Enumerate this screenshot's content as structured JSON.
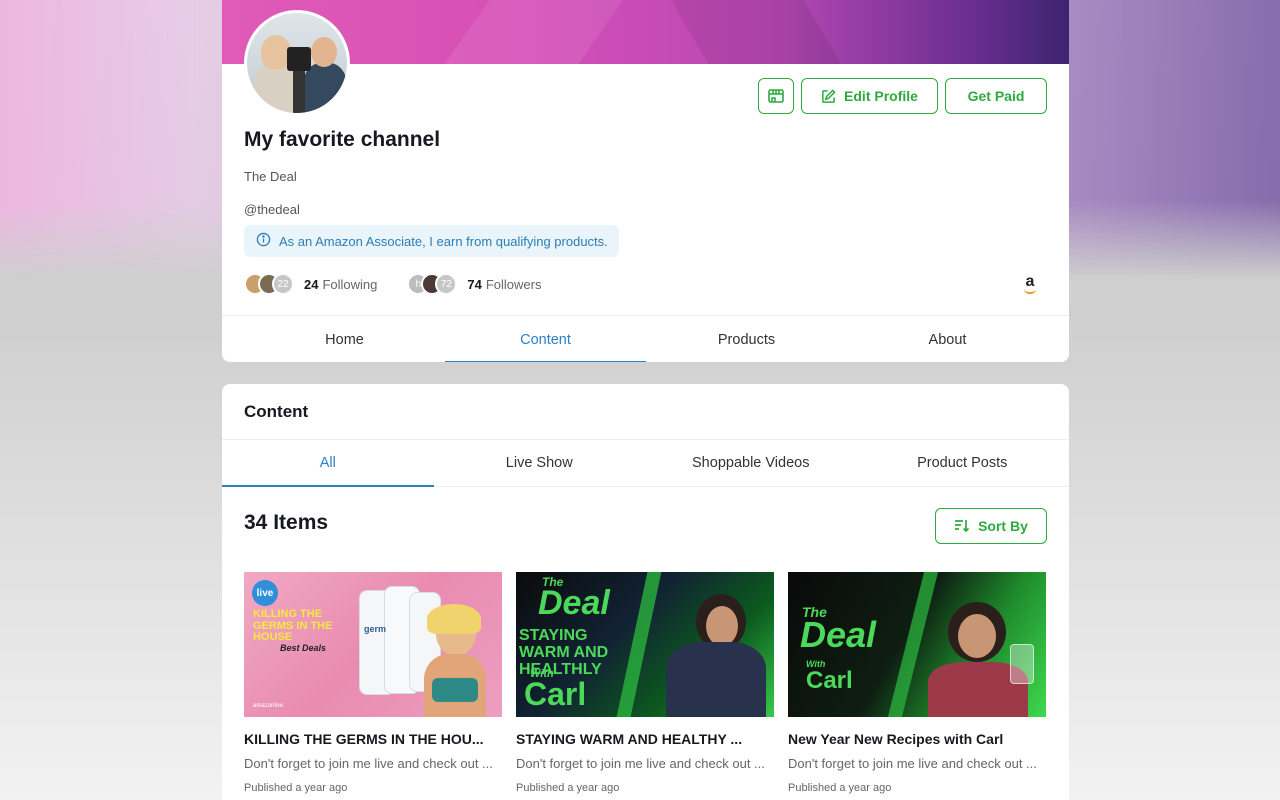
{
  "profile": {
    "title": "My favorite channel",
    "name": "The Deal",
    "handle": "@thedeal",
    "notice": "As an Amazon Associate, I earn from qualifying products.",
    "edit_label": "Edit Profile",
    "paid_label": "Get Paid",
    "following_count": "24",
    "following_label": "Following",
    "following_more": "22",
    "followers_count": "74",
    "followers_label": "Followers",
    "followers_more": "72",
    "followers_initial": "h",
    "amazon_letter": "a"
  },
  "tabs": [
    {
      "label": "Home"
    },
    {
      "label": "Content"
    },
    {
      "label": "Products"
    },
    {
      "label": "About"
    }
  ],
  "content": {
    "title": "Content",
    "subtabs": [
      {
        "label": "All"
      },
      {
        "label": "Live Show"
      },
      {
        "label": "Shoppable Videos"
      },
      {
        "label": "Product Posts"
      }
    ],
    "items_count": "34 Items",
    "sort_label": "Sort By",
    "cards": [
      {
        "title": "KILLING THE GERMS IN THE HOU...",
        "desc": "Don't forget to join me live and check out ...",
        "date": "Published a year ago",
        "thumb_text": "KILLING THE GERMS IN THE HOUSE",
        "thumb_sub": "Best Deals",
        "thumb_badge": "live",
        "thumb_footer": "amazonlive",
        "product_word": "germ"
      },
      {
        "title": "STAYING WARM AND HEALTHY ...",
        "desc": "Don't forget to join me live and check out ...",
        "date": "Published a year ago",
        "brand_top": "The",
        "brand_main": "Deal",
        "thumb_text": "STAYING WARM AND HEALTHLY",
        "thumb_with": "With",
        "thumb_name": "Carl"
      },
      {
        "title": "New Year New Recipes with Carl",
        "desc": "Don't forget to join me live and check out ...",
        "date": "Published a year ago",
        "brand_top": "The",
        "brand_main": "Deal",
        "thumb_with": "With",
        "thumb_name": "Carl"
      }
    ]
  },
  "colors": {
    "accent_green": "#2eaa3f",
    "accent_blue": "#2a82c8",
    "notice_bg": "#eaf4fb"
  },
  "icons": [
    "store-icon",
    "edit-icon",
    "info-icon",
    "sort-icon",
    "amazon-icon"
  ]
}
